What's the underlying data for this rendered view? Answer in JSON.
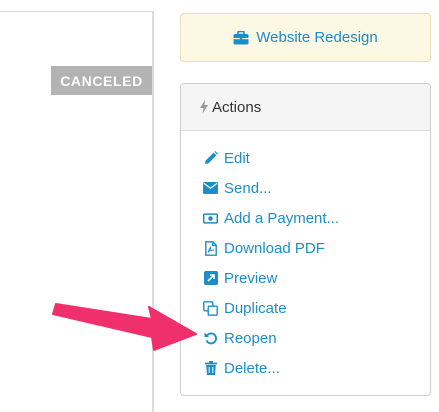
{
  "status_badge": {
    "label": "CANCELED",
    "color": "#b3b3b3"
  },
  "project": {
    "name": "Website Redesign",
    "icon": "briefcase-icon",
    "background": "#fcf8e3"
  },
  "actions": {
    "title": "Actions",
    "title_icon": "bolt-icon",
    "items": [
      {
        "label": "Edit",
        "icon": "pencil-icon"
      },
      {
        "label": "Send...",
        "icon": "envelope-icon"
      },
      {
        "label": "Add a Payment...",
        "icon": "money-icon"
      },
      {
        "label": "Download PDF",
        "icon": "pdf-file-icon"
      },
      {
        "label": "Preview",
        "icon": "external-link-icon"
      },
      {
        "label": "Duplicate",
        "icon": "copy-icon"
      },
      {
        "label": "Reopen",
        "icon": "undo-icon"
      },
      {
        "label": "Delete...",
        "icon": "trash-icon"
      }
    ]
  },
  "colors": {
    "link": "#1b8ec7",
    "annotation": "#f0306c"
  },
  "annotation": {
    "type": "arrow",
    "points_to": "Reopen"
  }
}
